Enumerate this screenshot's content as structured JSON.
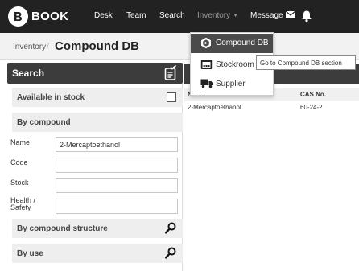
{
  "app": {
    "logo_text": "BOOK",
    "logo_icon": "b-logo-icon"
  },
  "nav": {
    "items": [
      {
        "label": "Desk"
      },
      {
        "label": "Team"
      },
      {
        "label": "Search"
      },
      {
        "label": "Inventory",
        "has_caret": true,
        "active": true
      },
      {
        "label": "Message",
        "icon": "envelope-icon"
      }
    ],
    "notifications_icon": "bell-icon"
  },
  "breadcrumb": {
    "parent": "Inventory",
    "current": "Compound DB"
  },
  "search_panel": {
    "title": "Search",
    "header_icon": "clipboard-check-icon",
    "available_in_stock": {
      "label": "Available in stock",
      "checked": false
    },
    "by_compound": {
      "label": "By compound",
      "fields": [
        {
          "label": "Name",
          "value": "2-Mercaptoethanol"
        },
        {
          "label": "Code",
          "value": ""
        },
        {
          "label": "Stock",
          "value": ""
        },
        {
          "label": "Health / Safety",
          "value": ""
        }
      ]
    },
    "by_compound_structure": {
      "label": "By compound structure",
      "icon": "search-icon"
    },
    "by_use": {
      "label": "By use",
      "icon": "search-icon"
    }
  },
  "results": {
    "columns": [
      "Name",
      "CAS No."
    ],
    "rows": [
      {
        "name": "2-Mercaptoethanol",
        "cas": "60-24-2"
      }
    ]
  },
  "inventory_menu": {
    "items": [
      {
        "label": "Compound DB",
        "icon": "compound-icon",
        "active": true
      },
      {
        "label": "Stockroom",
        "icon": "stockroom-icon"
      },
      {
        "label": "Supplier",
        "icon": "truck-icon"
      }
    ]
  },
  "tooltip": {
    "text": "Go to Compound DB section"
  },
  "colors": {
    "navbar": "#222222",
    "panel_header": "#3c3c3c",
    "menu_active": "#4a4a4a",
    "row_bg": "#eeeeee"
  }
}
